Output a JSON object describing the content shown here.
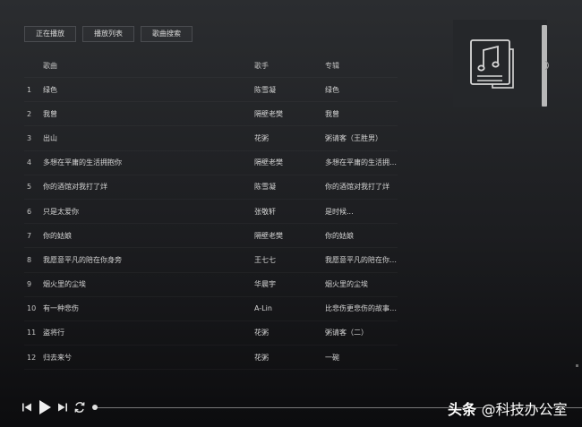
{
  "tabs": [
    {
      "label": "正在播放"
    },
    {
      "label": "播放列表"
    },
    {
      "label": "歌曲搜索"
    }
  ],
  "table": {
    "headers": {
      "title": "歌曲",
      "artist": "歌手",
      "album": "专辑"
    },
    "rows": [
      {
        "idx": "1",
        "title": "绿色",
        "artist": "陈雪凝",
        "album": "绿色"
      },
      {
        "idx": "2",
        "title": "我曾",
        "artist": "隔壁老樊",
        "album": "我曾"
      },
      {
        "idx": "3",
        "title": "出山",
        "artist": "花粥",
        "album": "粥请客（王胜男）"
      },
      {
        "idx": "4",
        "title": "多想在平庸的生活拥抱你",
        "artist": "隔壁老樊",
        "album": "多想在平庸的生活拥抱..."
      },
      {
        "idx": "5",
        "title": "你的酒馆对我打了烊",
        "artist": "陈雪凝",
        "album": "你的酒馆对我打了烊"
      },
      {
        "idx": "6",
        "title": "只是太爱你",
        "artist": "张敬轩",
        "album": "是时候..."
      },
      {
        "idx": "7",
        "title": "你的姑娘",
        "artist": "隔壁老樊",
        "album": "你的姑娘"
      },
      {
        "idx": "8",
        "title": "我愿意平凡的陪在你身旁",
        "artist": "王七七",
        "album": "我愿意平凡的陪在你身..."
      },
      {
        "idx": "9",
        "title": "烟火里的尘埃",
        "artist": "华晨宇",
        "album": "烟火里的尘埃"
      },
      {
        "idx": "10",
        "title": "有一种悲伤",
        "artist": "A-Lin",
        "album": "比悲伤更悲伤的故事 电..."
      },
      {
        "idx": "11",
        "title": "盗将行",
        "artist": "花粥",
        "album": "粥请客（二）"
      },
      {
        "idx": "12",
        "title": "归去来兮",
        "artist": "花粥",
        "album": "一碗"
      }
    ]
  },
  "player": {
    "progress": 0.0
  },
  "watermark": {
    "brand": "头条",
    "handle": "@科技办公室"
  },
  "colors": {
    "accent": "#e0e0e0",
    "background_top": "#2b2d30",
    "background_bottom": "#0c0c0e"
  },
  "icons": {
    "album_art": "music-document-icon",
    "prev": "skip-previous-icon",
    "play": "play-icon",
    "next": "skip-next-icon",
    "loop": "repeat-icon"
  }
}
